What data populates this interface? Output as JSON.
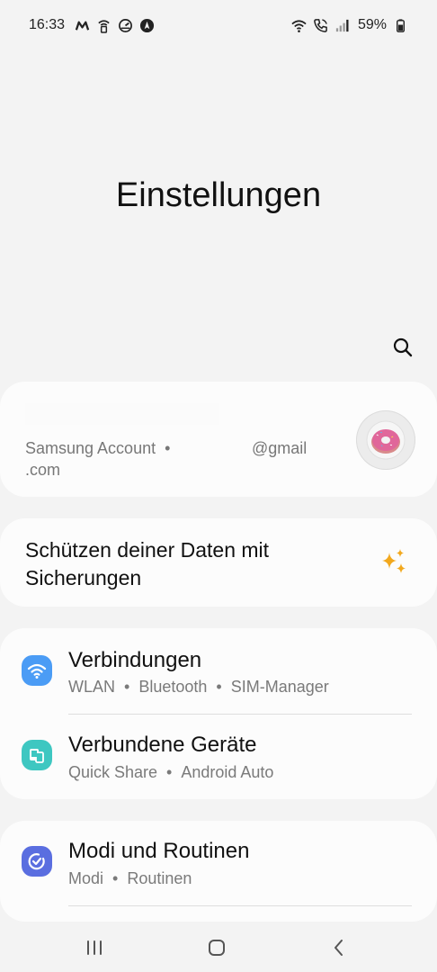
{
  "status_bar": {
    "time": "16:33",
    "battery": "59%",
    "left_icons": [
      "m-brand-icon",
      "wifi-calling-icon",
      "speedometer-icon",
      "nav-compass-icon"
    ],
    "right_icons": [
      "wifi-icon",
      "call-icon",
      "signal-icon",
      "battery-icon"
    ]
  },
  "header": {
    "title": "Einstellungen"
  },
  "account": {
    "service": "Samsung Account",
    "separator": "•",
    "email_suffix": "@gmail",
    "email_tld": ".com"
  },
  "backup": {
    "text": "Schützen deiner Daten mit Sicherungen"
  },
  "settings": [
    {
      "title": "Verbindungen",
      "subtitle": [
        "WLAN",
        "Bluetooth",
        "SIM-Manager"
      ],
      "icon": "wifi-icon",
      "color": "#4b9cf5"
    },
    {
      "title": "Verbundene Geräte",
      "subtitle": [
        "Quick Share",
        "Android Auto"
      ],
      "icon": "devices-icon",
      "color": "#3ec7c1"
    },
    {
      "title": "Modi und Routinen",
      "subtitle": [
        "Modi",
        "Routinen"
      ],
      "icon": "check-circle-icon",
      "color": "#5a6ee0"
    }
  ],
  "colors": {
    "background": "#f3f3f3",
    "card": "#fcfcfc",
    "sparkle": "#f2a81d"
  }
}
